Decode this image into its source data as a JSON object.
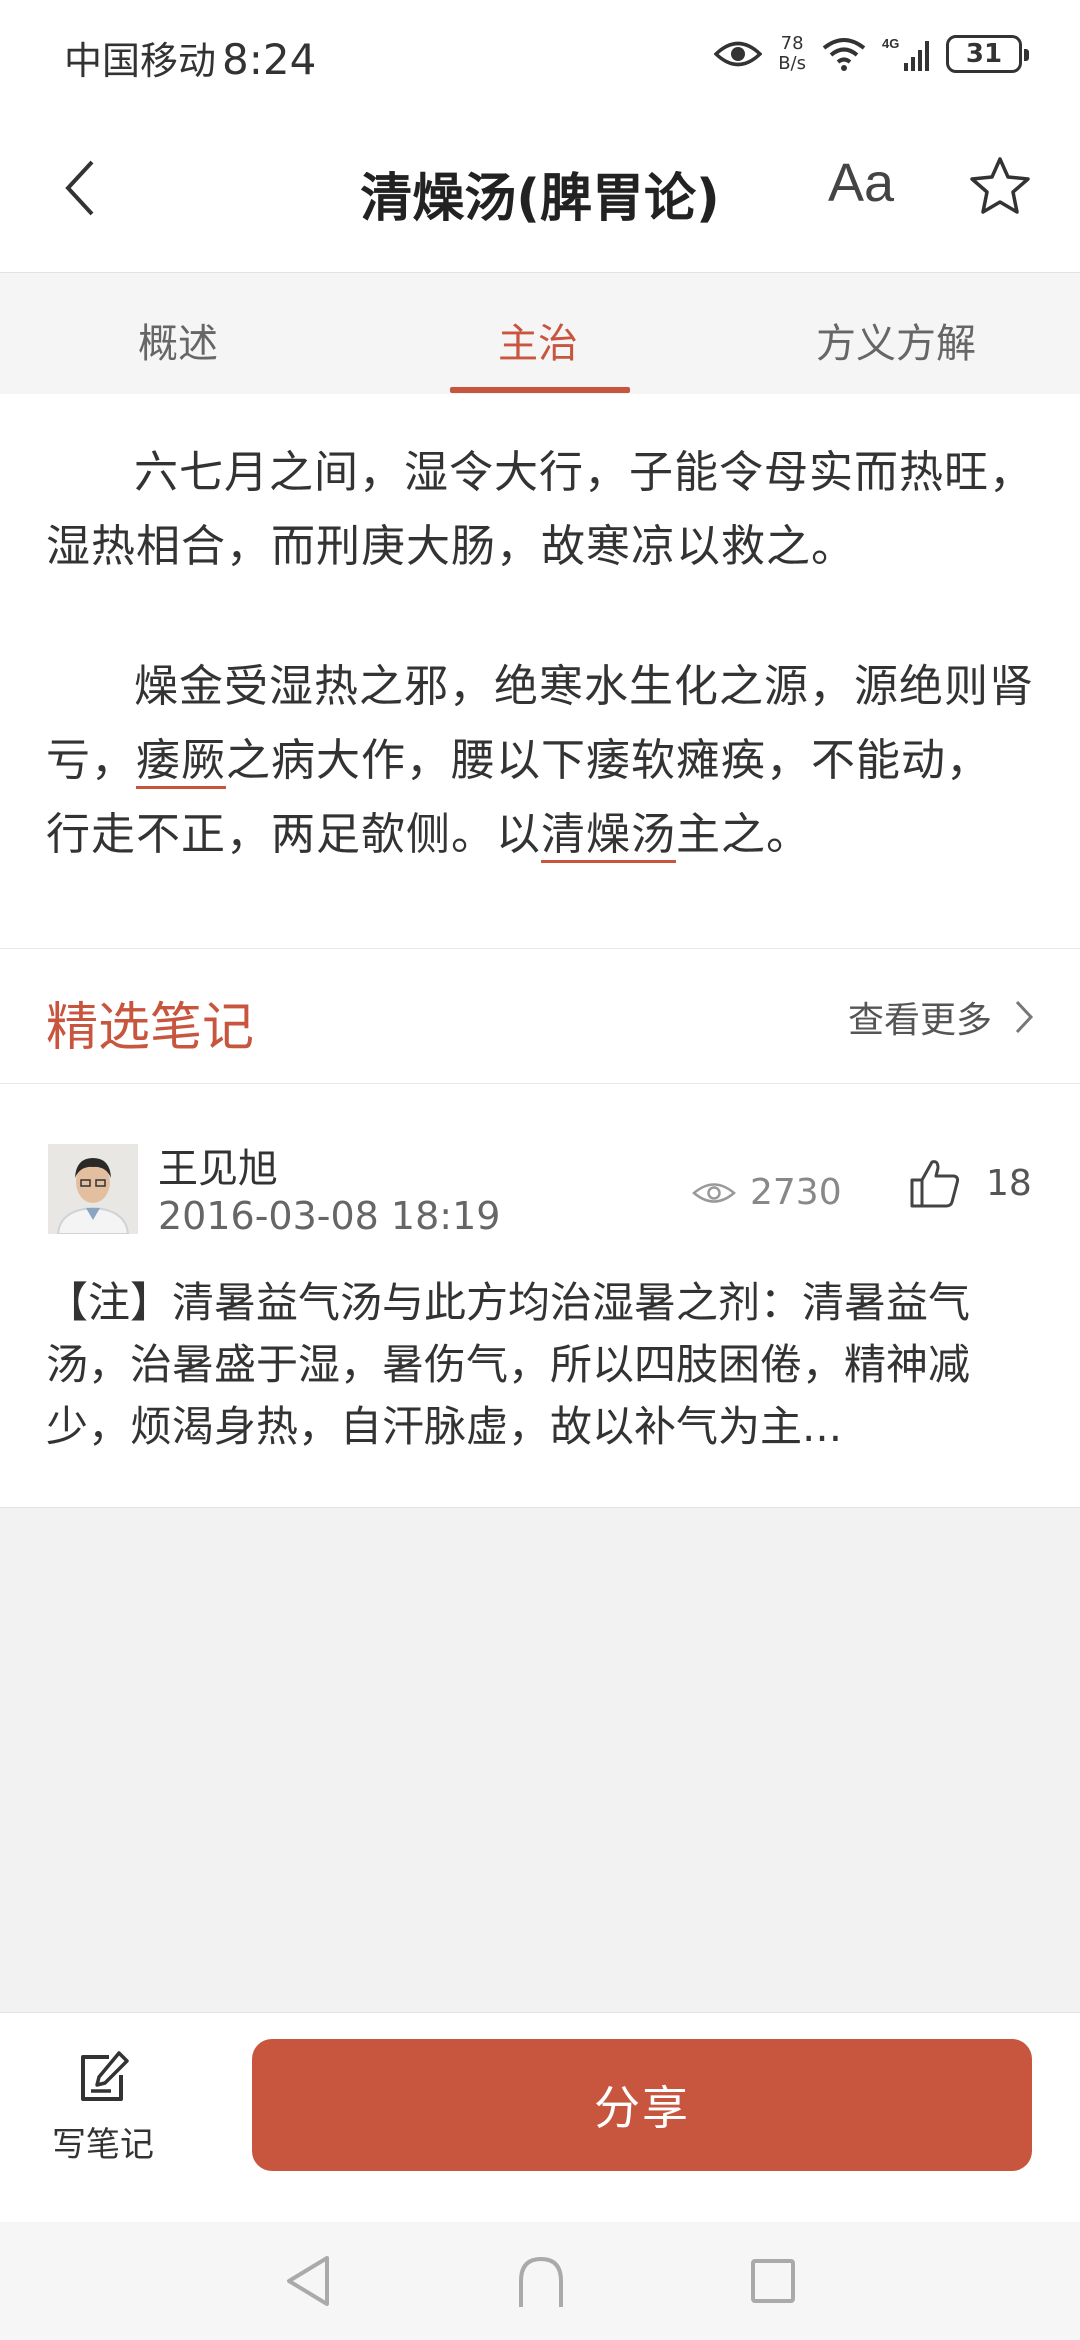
{
  "status_bar": {
    "carrier": "中国移动",
    "time": "8:24",
    "net_speed_value": "78",
    "net_speed_unit": "B/s",
    "network_type": "4G",
    "battery": "31"
  },
  "header": {
    "title": "清燥汤(脾胃论)",
    "font_size_label": "Aa"
  },
  "tabs": [
    {
      "label": "概述",
      "active": false
    },
    {
      "label": "主治",
      "active": true
    },
    {
      "label": "方义方解",
      "active": false
    }
  ],
  "content": {
    "para1": "六七月之间，湿令大行，子能令母实而热旺，湿热相合，而刑庚大肠，故寒凉以救之。",
    "para2_a": "燥金受湿热之邪，绝寒水生化之源，源绝则肾亏，",
    "para2_term1": "痿厥",
    "para2_b": "之病大作，腰以下痿软瘫痪，不能动，行走不正，两足欹侧。以",
    "para2_term2": "清燥汤",
    "para2_c": "主之。"
  },
  "featured_notes": {
    "title": "精选笔记",
    "more_label": "查看更多"
  },
  "note": {
    "author": "王见旭",
    "date": "2016-03-08 18:19",
    "views": "2730",
    "likes": "18",
    "text": "【注】清暑益气汤与此方均治湿暑之剂：清暑益气汤，治暑盛于湿，暑伤气，所以四肢困倦，精神减少，烦渴身热，自汗脉虚，故以补气为主..."
  },
  "bottom_bar": {
    "write_note_label": "写笔记",
    "share_label": "分享"
  },
  "colors": {
    "accent": "#c8553d",
    "background": "#f2f2f2"
  }
}
